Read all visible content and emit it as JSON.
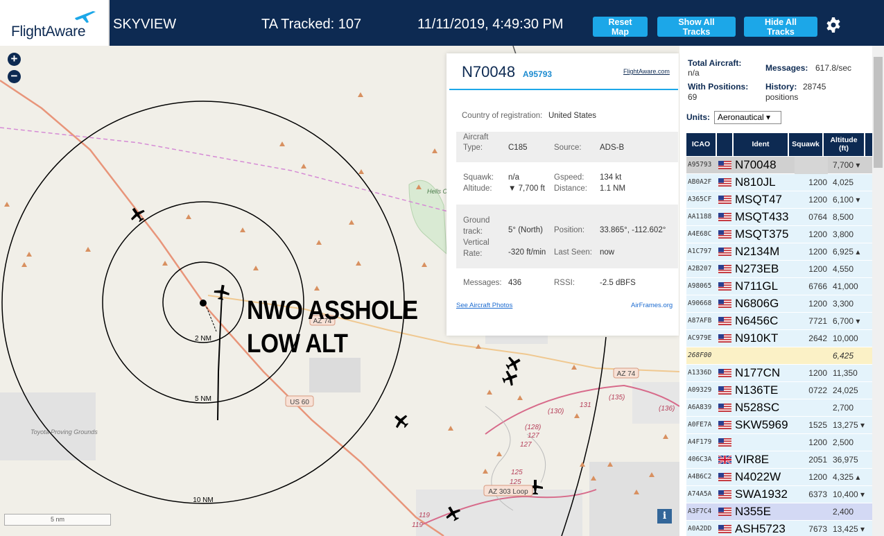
{
  "header": {
    "logo_text": "FlightAware",
    "site_name": "SKYVIEW",
    "ta_tracked": "TA Tracked: 107",
    "datetime": "11/11/2019, 4:49:30 PM",
    "reset_label": "Reset Map",
    "show_label": "Show All Tracks",
    "hide_label": "Hide All Tracks",
    "settings_icon": "gear-icon",
    "brand_color": "#0d2a52",
    "button_color": "#1ca7e8"
  },
  "map": {
    "zoom_in": "+",
    "zoom_out": "−",
    "scale_label": "5 nm",
    "info_label": "i",
    "annotation_line1": "NWO ASSHOLE",
    "annotation_line2": "LOW ALT",
    "range_rings": [
      "2 NM",
      "5 NM",
      "10 NM"
    ],
    "road_labels": [
      "AZ 74",
      "AZ 74",
      "US 60",
      "AZ 303 Loop"
    ],
    "road_numbers": [
      "131",
      "(135)",
      "(130)",
      "(128)",
      "127",
      "127",
      "125",
      "125",
      "(136)",
      "119",
      "119"
    ],
    "place_labels": [
      "Hells Canyon Wilderness",
      "Toyota Proving Grounds"
    ]
  },
  "popup": {
    "registration": "N70048",
    "icao": "A95793",
    "fa_link": "FlightAware.com",
    "country_label": "Country of registration:",
    "country": "United States",
    "aircraft_type_label": "Aircraft Type:",
    "aircraft_type": "C185",
    "source_label": "Source:",
    "source": "ADS-B",
    "squawk_label": "Squawk:",
    "squawk": "n/a",
    "gspeed_label": "Gspeed:",
    "gspeed": "134 kt",
    "altitude_label": "Altitude:",
    "altitude": "▼ 7,700 ft",
    "distance_label": "Distance:",
    "distance": "1.1 NM",
    "ground_track_label": "Ground track:",
    "ground_track": "5° (North)",
    "position_label": "Position:",
    "position": "33.865°, -112.602°",
    "vrate_label": "Vertical Rate:",
    "vrate": "-320 ft/min",
    "last_seen_label": "Last Seen:",
    "last_seen": "now",
    "messages_label": "Messages:",
    "messages": "436",
    "rssi_label": "RSSI:",
    "rssi": "-2.5 dBFS",
    "photos_link": "See Aircraft Photos",
    "airframes_link": "AirFrames.org"
  },
  "panel": {
    "total_label": "Total Aircraft:",
    "total_value": "n/a",
    "messages_label": "Messages:",
    "messages_value": "617.8/sec",
    "positions_label": "With Positions:",
    "positions_value": "69",
    "history_label": "History:",
    "history_value": "28745",
    "history_unit": "positions",
    "units_label": "Units:",
    "units_value": "Aeronautical ▾",
    "columns": [
      "ICAO",
      "Ident",
      "Squawk",
      "Altitude (ft)"
    ]
  },
  "rows": [
    {
      "icao": "A95793",
      "flag": "us",
      "ident": "N70048",
      "squawk": "",
      "alt": "7,700 ▾",
      "style": "sel"
    },
    {
      "icao": "AB0A2F",
      "flag": "us",
      "ident": "N810JL",
      "squawk": "1200",
      "alt": "4,025",
      "style": ""
    },
    {
      "icao": "A365CF",
      "flag": "us",
      "ident": "MSQT47",
      "squawk": "1200",
      "alt": "6,100 ▾",
      "style": ""
    },
    {
      "icao": "AA1188",
      "flag": "us",
      "ident": "MSQT433",
      "squawk": "0764",
      "alt": "8,500",
      "style": ""
    },
    {
      "icao": "A4E68C",
      "flag": "us",
      "ident": "MSQT375",
      "squawk": "1200",
      "alt": "3,800",
      "style": ""
    },
    {
      "icao": "A1C797",
      "flag": "us",
      "ident": "N2134M",
      "squawk": "1200",
      "alt": "6,925 ▴",
      "style": ""
    },
    {
      "icao": "A2B207",
      "flag": "us",
      "ident": "N273EB",
      "squawk": "1200",
      "alt": "4,550",
      "style": ""
    },
    {
      "icao": "A98065",
      "flag": "us",
      "ident": "N711GL",
      "squawk": "6766",
      "alt": "41,000",
      "style": ""
    },
    {
      "icao": "A90668",
      "flag": "us",
      "ident": "N6806G",
      "squawk": "1200",
      "alt": "3,300",
      "style": ""
    },
    {
      "icao": "A87AFB",
      "flag": "us",
      "ident": "N6456C",
      "squawk": "7721",
      "alt": "6,700 ▾",
      "style": ""
    },
    {
      "icao": "AC979E",
      "flag": "us",
      "ident": "N910KT",
      "squawk": "2642",
      "alt": "10,000",
      "style": ""
    },
    {
      "icao": "268F00",
      "flag": "",
      "ident": "",
      "squawk": "",
      "alt": "6,425",
      "style": "nopos"
    },
    {
      "icao": "A1336D",
      "flag": "us",
      "ident": "N177CN",
      "squawk": "1200",
      "alt": "11,350",
      "style": ""
    },
    {
      "icao": "A09329",
      "flag": "us",
      "ident": "N136TE",
      "squawk": "0722",
      "alt": "24,025",
      "style": ""
    },
    {
      "icao": "A6A839",
      "flag": "us",
      "ident": "N528SC",
      "squawk": "",
      "alt": "2,700",
      "style": ""
    },
    {
      "icao": "A0FE7A",
      "flag": "us",
      "ident": "SKW5969",
      "squawk": "1525",
      "alt": "13,275 ▾",
      "style": ""
    },
    {
      "icao": "A4F179",
      "flag": "us",
      "ident": "",
      "squawk": "1200",
      "alt": "2,500",
      "style": ""
    },
    {
      "icao": "406C3A",
      "flag": "uk",
      "ident": "VIR8E",
      "squawk": "2051",
      "alt": "36,975",
      "style": ""
    },
    {
      "icao": "A4B6C2",
      "flag": "us",
      "ident": "N4022W",
      "squawk": "1200",
      "alt": "4,325 ▴",
      "style": ""
    },
    {
      "icao": "A74A5A",
      "flag": "us",
      "ident": "SWA1932",
      "squawk": "6373",
      "alt": "10,400 ▾",
      "style": ""
    },
    {
      "icao": "A3F7C4",
      "flag": "us",
      "ident": "N355E",
      "squawk": "",
      "alt": "2,400",
      "style": "alt"
    },
    {
      "icao": "A0A2DD",
      "flag": "us",
      "ident": "ASH5723",
      "squawk": "7673",
      "alt": "13,425 ▾",
      "style": ""
    }
  ]
}
